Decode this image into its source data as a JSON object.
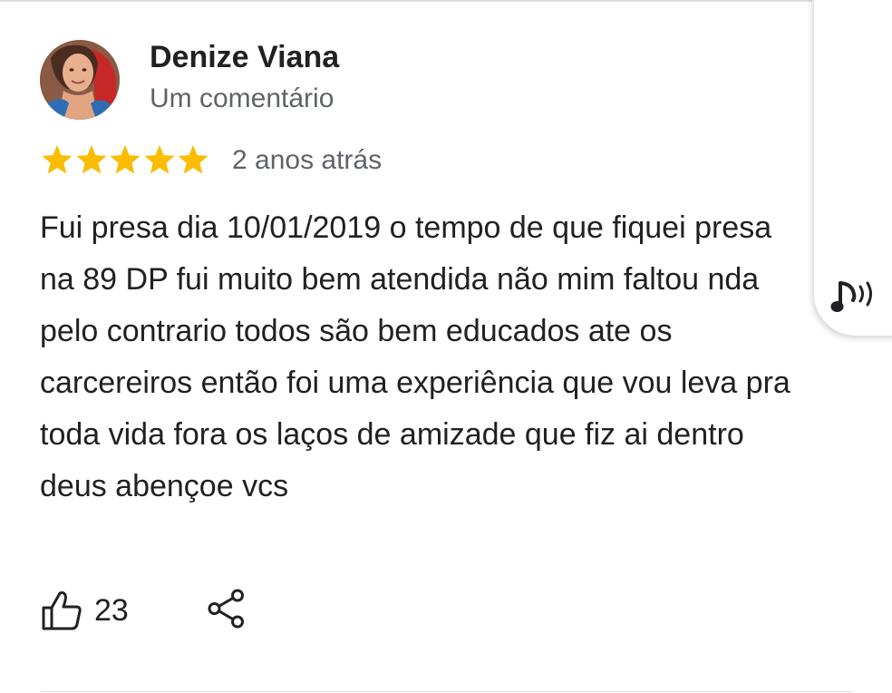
{
  "review": {
    "author_name": "Denize Viana",
    "author_meta": "Um comentário",
    "rating": 5,
    "rating_max": 5,
    "time": "2 anos atrás",
    "text": "Fui presa dia 10/01/2019 o tempo de que fiquei presa na 89 DP fui muito bem atendida não mim faltou nda pelo contrario todos são bem educados ate os carcereiros então foi uma experiência que vou leva pra toda vida fora os laços de amizade que fiz ai dentro deus abençoe vcs",
    "likes": "23"
  },
  "icons": {
    "like": "thumbs-up-icon",
    "share": "share-icon",
    "listen": "read-aloud-icon",
    "star": "star-icon"
  },
  "colors": {
    "star": "#fbbc04",
    "primary_text": "#202124",
    "secondary_text": "#5f6368"
  }
}
